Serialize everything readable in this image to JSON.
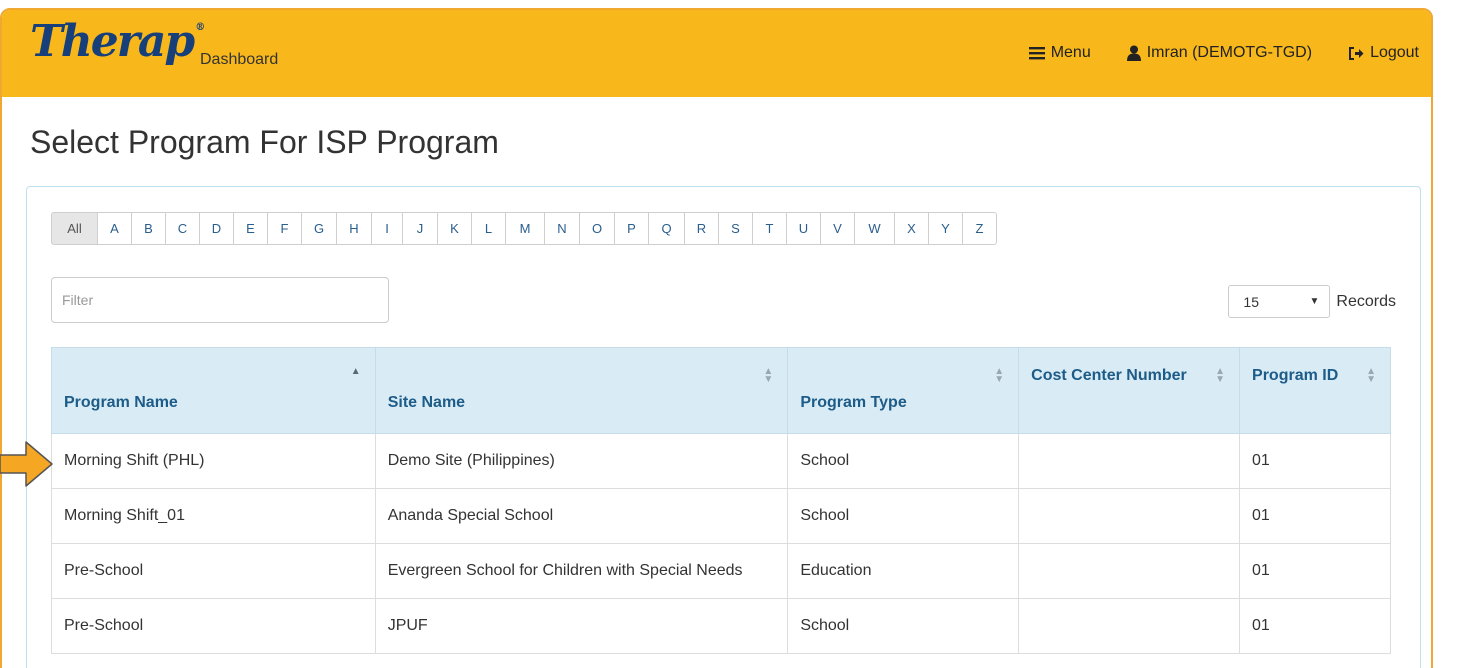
{
  "app": {
    "brand": "Therap",
    "dashboard_label": "Dashboard"
  },
  "nav": {
    "menu_label": "Menu",
    "user_label": "Imran (DEMOTG-TGD)",
    "logout_label": "Logout"
  },
  "page": {
    "title": "Select Program For ISP Program"
  },
  "alphabet": [
    "All",
    "A",
    "B",
    "C",
    "D",
    "E",
    "F",
    "G",
    "H",
    "I",
    "J",
    "K",
    "L",
    "M",
    "N",
    "O",
    "P",
    "Q",
    "R",
    "S",
    "T",
    "U",
    "V",
    "W",
    "X",
    "Y",
    "Z"
  ],
  "filter": {
    "placeholder": "Filter",
    "value": ""
  },
  "records": {
    "selected": "15",
    "label": "Records"
  },
  "table": {
    "columns": [
      "Program Name",
      "Site Name",
      "Program Type",
      "Cost Center Number",
      "Program ID"
    ],
    "rows": [
      [
        "Morning Shift (PHL)",
        "Demo Site (Philippines)",
        "School",
        "",
        "01"
      ],
      [
        "Morning Shift_01",
        "Ananda Special School",
        "School",
        "",
        "01"
      ],
      [
        "Pre-School",
        "Evergreen School for Children with Special Needs",
        "Education",
        "",
        "01"
      ],
      [
        "Pre-School",
        "JPUF",
        "School",
        "",
        "01"
      ]
    ]
  },
  "colors": {
    "header_bar": "#f8b81b",
    "frame_border": "#f0a830",
    "brand_text": "#173f7a",
    "table_header_bg": "#d9ecf5",
    "link_blue": "#1d5c89",
    "pointer_arrow": "#f5a623"
  },
  "icons": {
    "menu": "hamburger-icon",
    "user": "user-icon",
    "logout": "logout-icon",
    "sort": "sort-icon",
    "pointer": "arrow-right-icon"
  }
}
